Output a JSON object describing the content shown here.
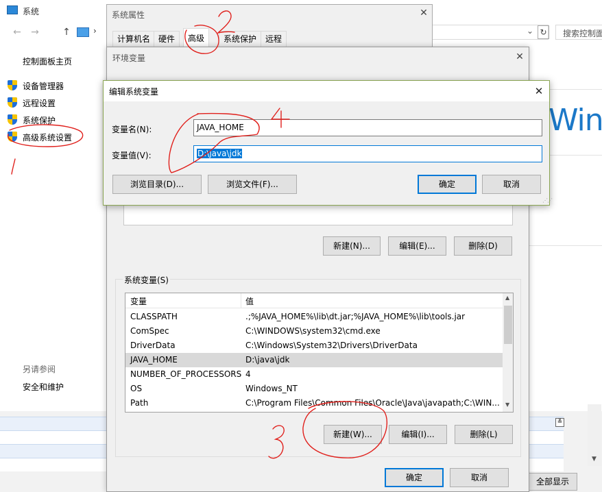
{
  "system_window": {
    "title": "系统",
    "nav_back": "←",
    "nav_forward": "→",
    "nav_up": "↑",
    "address_separator": "›",
    "address_dropdown": "⌄",
    "refresh": "↻",
    "search_placeholder": "搜索控制面板",
    "left_links": {
      "home": "控制面板主页",
      "device_manager": "设备管理器",
      "remote": "远程设置",
      "protection": "系统保护",
      "advanced": "高级系统设置"
    },
    "see_also": "另请参阅",
    "security_link": "安全和维护",
    "brand_text": "Wind",
    "show_all": "全部显示",
    "collapse": "≚"
  },
  "sysprop": {
    "title": "系统属性",
    "close": "✕",
    "tabs": [
      "计算机名",
      "硬件",
      "高级",
      "系统保护",
      "远程"
    ]
  },
  "envvar": {
    "title": "环境变量",
    "close": "✕",
    "user_buttons": {
      "new": "新建(N)...",
      "edit": "编辑(E)...",
      "delete": "删除(D)"
    },
    "sys_group_label": "系统变量(S)",
    "columns": {
      "name": "变量",
      "value": "值"
    },
    "rows": [
      {
        "name": "CLASSPATH",
        "value": ".;%JAVA_HOME%\\lib\\dt.jar;%JAVA_HOME%\\lib\\tools.jar"
      },
      {
        "name": "ComSpec",
        "value": "C:\\WINDOWS\\system32\\cmd.exe"
      },
      {
        "name": "DriverData",
        "value": "C:\\Windows\\System32\\Drivers\\DriverData"
      },
      {
        "name": "JAVA_HOME",
        "value": "D:\\java\\jdk"
      },
      {
        "name": "NUMBER_OF_PROCESSORS",
        "value": "4"
      },
      {
        "name": "OS",
        "value": "Windows_NT"
      },
      {
        "name": "Path",
        "value": "C:\\Program Files\\Common Files\\Oracle\\Java\\javapath;C:\\WIN..."
      }
    ],
    "selected_row": "JAVA_HOME",
    "sys_buttons": {
      "new": "新建(W)...",
      "edit": "编辑(I)...",
      "delete": "删除(L)"
    },
    "ok": "确定",
    "cancel": "取消",
    "scroll_up": "▲",
    "scroll_down": "▼"
  },
  "editvar": {
    "title": "编辑系统变量",
    "close": "✕",
    "name_label": "变量名(N):",
    "name_value": "JAVA_HOME",
    "value_label": "变量值(V):",
    "value_value": "D:\\java\\jdk",
    "browse_dir": "浏览目录(D)...",
    "browse_file": "浏览文件(F)...",
    "ok": "确定",
    "cancel": "取消"
  },
  "annotations": {
    "n1": "1",
    "n2": "2",
    "n3": "3",
    "n4": "4",
    "color": "#e0201c"
  }
}
